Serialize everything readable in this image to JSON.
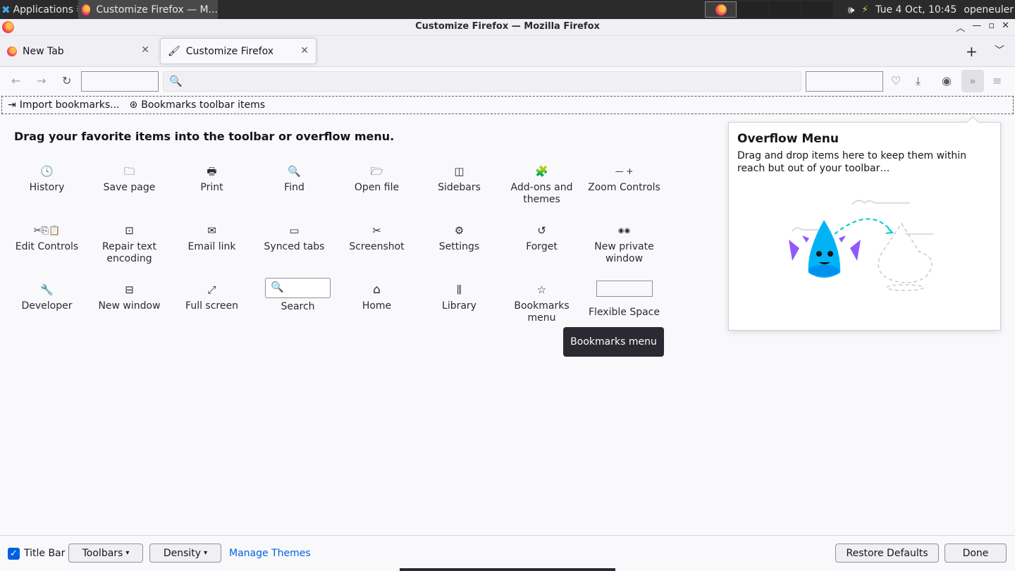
{
  "panel": {
    "apps_label": "Applications",
    "apps_suffix": "☰",
    "task_title": "Customize Firefox — M...",
    "datetime": "Tue  4 Oct, 10:45",
    "user": "openeuler"
  },
  "window": {
    "title": "Customize Firefox — Mozilla Firefox"
  },
  "tabs": [
    {
      "label": "New Tab"
    },
    {
      "label": "Customize Firefox"
    }
  ],
  "bookmarks": {
    "items": [
      {
        "label": "Import bookmarks...",
        "icon": "import-icon"
      },
      {
        "label": "Bookmarks toolbar items",
        "icon": "star-folder-icon"
      }
    ]
  },
  "palette": {
    "heading": "Drag your favorite items into the toolbar or overflow menu.",
    "rows": [
      [
        {
          "label": "History",
          "icon": "history-icon",
          "glyph": "🕓"
        },
        {
          "label": "Save page",
          "icon": "save-page-icon",
          "glyph": "🗀"
        },
        {
          "label": "Print",
          "icon": "print-icon",
          "glyph": "🖶"
        },
        {
          "label": "Find",
          "icon": "find-icon",
          "glyph": "🔍"
        },
        {
          "label": "Open file",
          "icon": "open-file-icon",
          "glyph": "🗁"
        },
        {
          "label": "Sidebars",
          "icon": "sidebars-icon",
          "glyph": "◫"
        },
        {
          "label": "Add-ons and themes",
          "icon": "addons-icon",
          "glyph": "🧩"
        },
        {
          "label": "Zoom Controls",
          "icon": "zoom-controls-icon",
          "glyph": "—  +"
        }
      ],
      [
        {
          "label": "Edit Controls",
          "icon": "edit-controls-icon",
          "glyph": "✂⎘📋"
        },
        {
          "label": "Repair text encoding",
          "icon": "repair-encoding-icon",
          "glyph": "⊡"
        },
        {
          "label": "Email link",
          "icon": "email-link-icon",
          "glyph": "✉"
        },
        {
          "label": "Synced tabs",
          "icon": "synced-tabs-icon",
          "glyph": "▭"
        },
        {
          "label": "Screenshot",
          "icon": "screenshot-icon",
          "glyph": "✂"
        },
        {
          "label": "Settings",
          "icon": "settings-icon",
          "glyph": "⚙"
        },
        {
          "label": "Forget",
          "icon": "forget-icon",
          "glyph": "↺"
        },
        {
          "label": "New private window",
          "icon": "private-window-icon",
          "glyph": "◉◉"
        }
      ],
      [
        {
          "label": "Developer",
          "icon": "developer-icon",
          "glyph": "🔧"
        },
        {
          "label": "New window",
          "icon": "new-window-icon",
          "glyph": "⊟"
        },
        {
          "label": "Full screen",
          "icon": "full-screen-icon",
          "glyph": "⤢"
        },
        {
          "label": "Search",
          "icon": "search-icon",
          "glyph": "🔍"
        },
        {
          "label": "Home",
          "icon": "home-icon",
          "glyph": "⌂"
        },
        {
          "label": "Library",
          "icon": "library-icon",
          "glyph": "⫼"
        },
        {
          "label": "Bookmarks menu",
          "icon": "bookmarks-menu-icon",
          "glyph": "☆"
        },
        {
          "label": "Flexible Space",
          "icon": "flexible-space-icon",
          "glyph": ""
        }
      ]
    ]
  },
  "tooltip": "Bookmarks menu",
  "overflow": {
    "title": "Overflow Menu",
    "description": "Drag and drop items here to keep them within reach but out of your toolbar…"
  },
  "footer": {
    "title_bar_label": "Title Bar",
    "title_bar_checked": true,
    "toolbars_label": "Toolbars",
    "density_label": "Density",
    "manage_themes_label": "Manage Themes",
    "restore_label": "Restore Defaults",
    "done_label": "Done"
  }
}
